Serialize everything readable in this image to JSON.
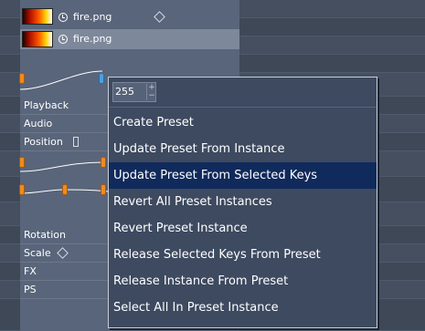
{
  "colors": {
    "background": "#3c4655",
    "panel": "#59657a",
    "menu_bg": "#3d4a60",
    "menu_selected": "#102a5c",
    "key_orange": "#f08a20"
  },
  "files": [
    {
      "name": "fire.png",
      "icon": "clock-icon"
    },
    {
      "name": "fire.png",
      "icon": "clock-icon"
    }
  ],
  "tracks": {
    "playback": "Playback",
    "audio": "Audio",
    "position": "Position",
    "rotation": "Rotation",
    "scale": "Scale",
    "fx": "FX",
    "ps": "PS"
  },
  "menu": {
    "value": "255",
    "items": [
      {
        "label": "Create Preset",
        "selected": false
      },
      {
        "label": "Update Preset From Instance",
        "selected": false
      },
      {
        "label": "Update Preset From Selected Keys",
        "selected": true
      },
      {
        "label": "Revert All Preset Instances",
        "selected": false
      },
      {
        "label": "Revert Preset Instance",
        "selected": false
      },
      {
        "label": "Release Selected Keys From Preset",
        "selected": false
      },
      {
        "label": "Release Instance From Preset",
        "selected": false
      },
      {
        "label": "Select All In Preset Instance",
        "selected": false
      }
    ]
  }
}
